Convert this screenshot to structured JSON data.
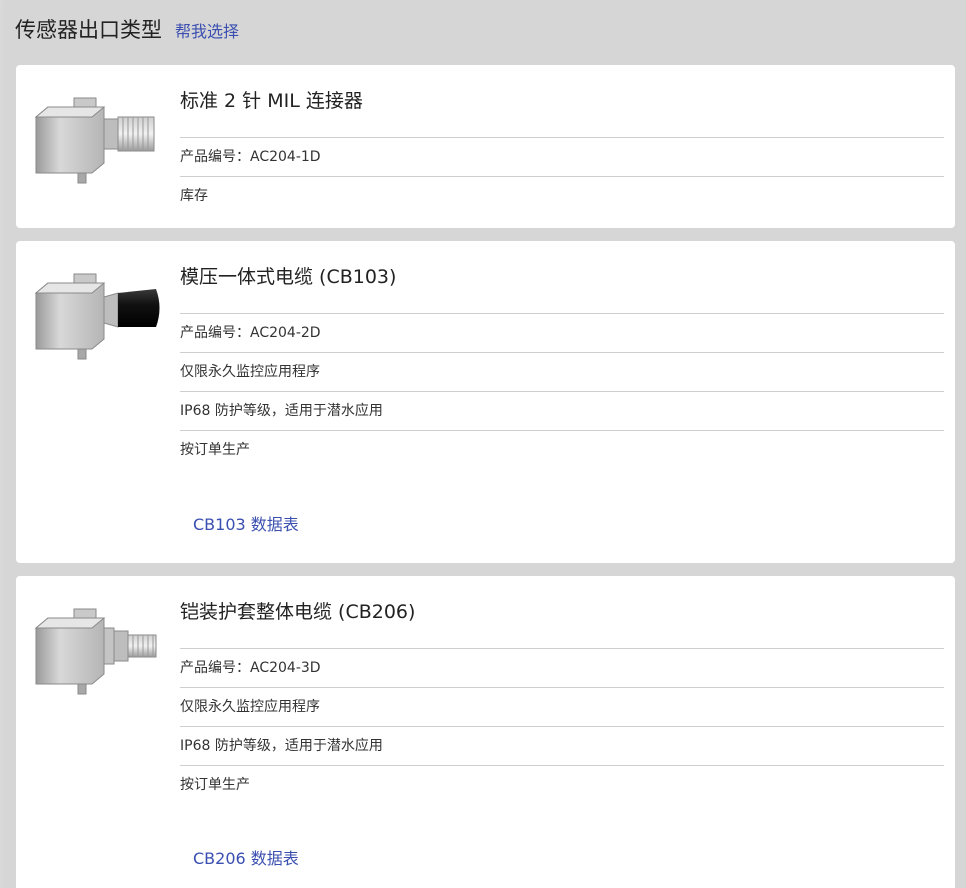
{
  "header": {
    "title": "传感器出口类型",
    "help_link": "帮我选择"
  },
  "products": [
    {
      "title": "标准 2 针 MIL 连接器",
      "part_number": "产品编号：AC204-1D",
      "notes": [
        "库存"
      ],
      "image_icon": "sensor-mil-connector-icon",
      "datasheet": null
    },
    {
      "title": "模压一体式电缆 (CB103)",
      "part_number": "产品编号：AC204-2D",
      "notes": [
        "仅限永久监控应用程序",
        "IP68 防护等级，适用于潜水应用",
        "按订单生产"
      ],
      "image_icon": "sensor-molded-cable-icon",
      "datasheet": "CB103 数据表"
    },
    {
      "title": "铠装护套整体电缆 (CB206)",
      "part_number": "产品编号：AC204-3D",
      "notes": [
        "仅限永久监控应用程序",
        "IP68 防护等级，适用于潜水应用",
        "按订单生产"
      ],
      "image_icon": "sensor-armored-cable-icon",
      "datasheet": "CB206 数据表"
    }
  ],
  "colors": {
    "background": "#d6d6d6",
    "card": "#ffffff",
    "link": "#3a4fb0",
    "divider": "#cfcfcf"
  }
}
